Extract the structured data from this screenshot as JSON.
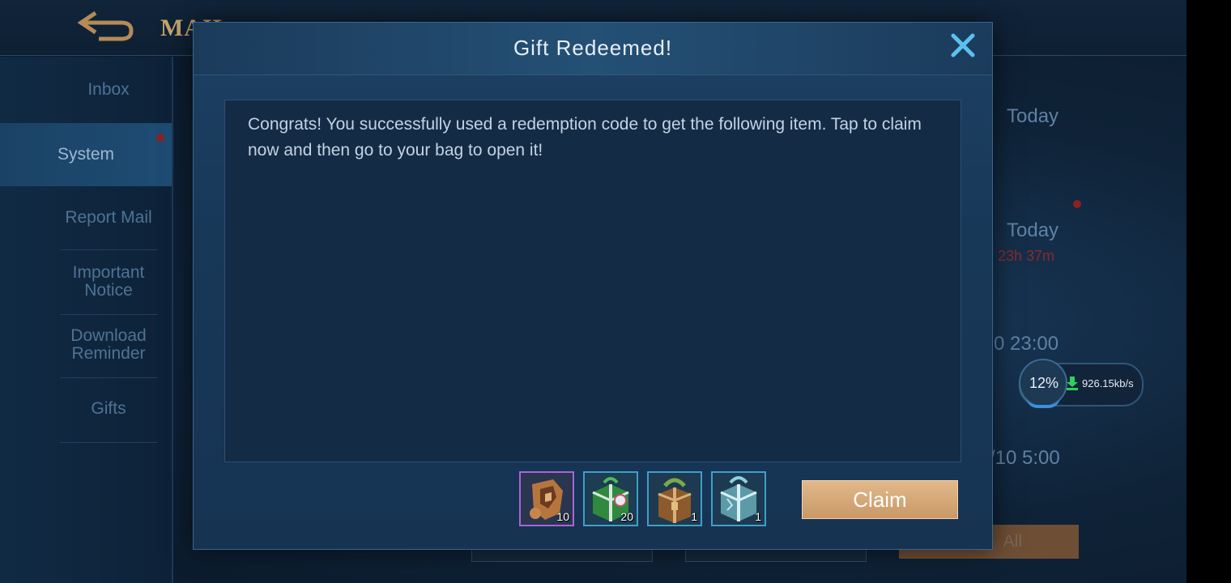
{
  "background": {
    "title": "MAIL",
    "sidebar": {
      "items": [
        {
          "label": "Inbox"
        },
        {
          "label": "System"
        },
        {
          "label": "Report Mail"
        },
        {
          "label": "Important Notice"
        },
        {
          "label": "Download Reminder"
        },
        {
          "label": "Gifts"
        }
      ]
    },
    "mail_list": {
      "dates": [
        "Today",
        "Today",
        "0 23:00",
        "/10 5:00"
      ],
      "timer": "23h 37m"
    },
    "claim_all_label": "All"
  },
  "download_widget": {
    "percent_label": "12%",
    "percent_value": 12,
    "speed": "926.15kb/s"
  },
  "dialog": {
    "title": "Gift Redeemed!",
    "message": "Congrats! You successfully used a redemption code to get the following item. Tap to claim now and then go to your bag to open it!",
    "items": [
      {
        "icon": "hero-fragment-icon",
        "qty": "10",
        "rarity": "epic"
      },
      {
        "icon": "green-gift-box-icon",
        "qty": "20",
        "rarity": "rare"
      },
      {
        "icon": "bronze-chest-icon",
        "qty": "1",
        "rarity": "rare"
      },
      {
        "icon": "crystal-gift-box-icon",
        "qty": "1",
        "rarity": "rare"
      }
    ],
    "claim_label": "Claim"
  },
  "colors": {
    "accent_gold": "#d4a878",
    "close_blue": "#5bc0f0",
    "epic_border": "#a765d8",
    "rare_border": "#3f9ec8"
  }
}
